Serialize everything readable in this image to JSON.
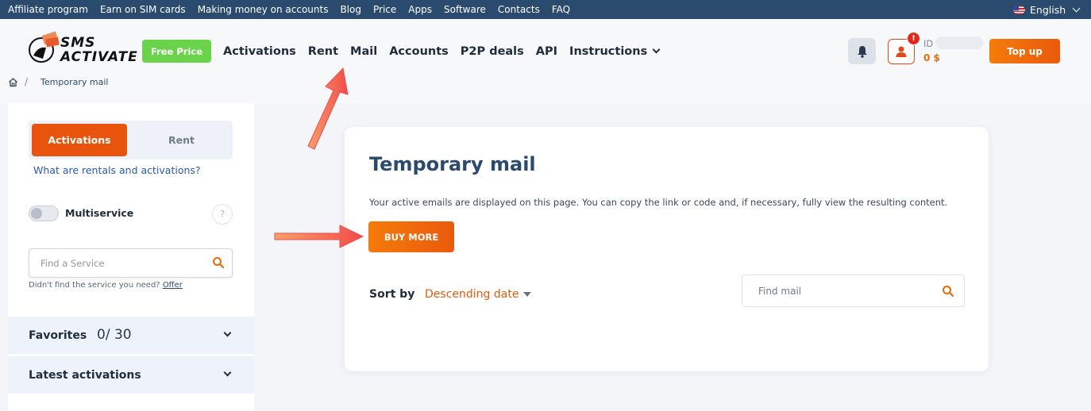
{
  "topbar": {
    "links": [
      "Affiliate program",
      "Earn on SIM cards",
      "Making money on accounts",
      "Blog",
      "Price",
      "Apps",
      "Software",
      "Contacts",
      "FAQ"
    ],
    "language": "English"
  },
  "header": {
    "logo_line1": "SMS",
    "logo_line2": "ACTIVATE",
    "free_price": "Free Price",
    "nav": [
      "Activations",
      "Rent",
      "Mail",
      "Accounts",
      "P2P deals",
      "API"
    ],
    "instructions": "Instructions",
    "user_badge": "!",
    "id_label": "ID",
    "balance": "0 $",
    "top_up": "Top up"
  },
  "breadcrumb": {
    "current": "Temporary mail",
    "separator": "/"
  },
  "sidebar": {
    "tab_activations": "Activations",
    "tab_rent": "Rent",
    "what_link": "What are rentals and activations?",
    "multiservice": "Multiservice",
    "help": "?",
    "search_placeholder": "Find a Service",
    "didnt_find": "Didn't find the service you need?",
    "offer": "Offer",
    "favorites": "Favorites",
    "favorites_count": "0/ 30",
    "latest": "Latest activations"
  },
  "main": {
    "title": "Temporary mail",
    "description": "Your active emails are displayed on this page. You can copy the link or code and, if necessary, fully view the resulting content.",
    "buy_more": "BUY MORE",
    "sort_by": "Sort by",
    "sort_value": "Descending date",
    "mail_placeholder": "Find mail"
  },
  "colors": {
    "topbar": "#2a4a6e",
    "accent": "#e8540c",
    "free_price": "#69d34a",
    "annotation_arrow": "#f24b4b"
  }
}
